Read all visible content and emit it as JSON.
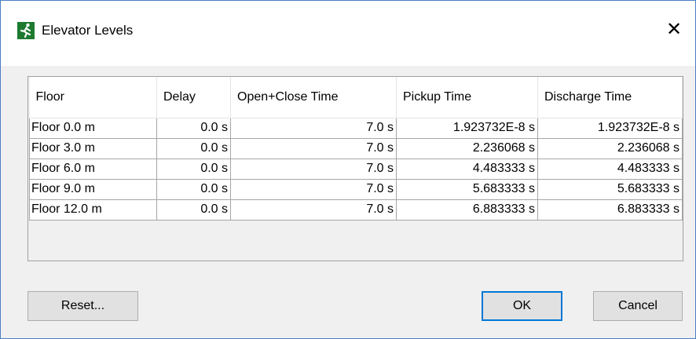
{
  "window": {
    "title": "Elevator Levels",
    "close_glyph": "✕",
    "icon": "running-man-exit-icon"
  },
  "table": {
    "columns": [
      "Floor",
      "Delay",
      "Open+Close Time",
      "Pickup Time",
      "Discharge Time"
    ],
    "rows": [
      [
        "Floor 0.0 m",
        "0.0 s",
        "7.0 s",
        "1.923732E-8 s",
        "1.923732E-8 s"
      ],
      [
        "Floor 3.0 m",
        "0.0 s",
        "7.0 s",
        "2.236068 s",
        "2.236068 s"
      ],
      [
        "Floor 6.0 m",
        "0.0 s",
        "7.0 s",
        "4.483333 s",
        "4.483333 s"
      ],
      [
        "Floor 9.0 m",
        "0.0 s",
        "7.0 s",
        "5.683333 s",
        "5.683333 s"
      ],
      [
        "Floor 12.0 m",
        "0.0 s",
        "7.0 s",
        "6.883333 s",
        "6.883333 s"
      ]
    ]
  },
  "buttons": {
    "reset": "Reset...",
    "ok": "OK",
    "cancel": "Cancel"
  },
  "colors": {
    "accent": "#0078d7",
    "icon_bg": "#1d7a2e"
  }
}
